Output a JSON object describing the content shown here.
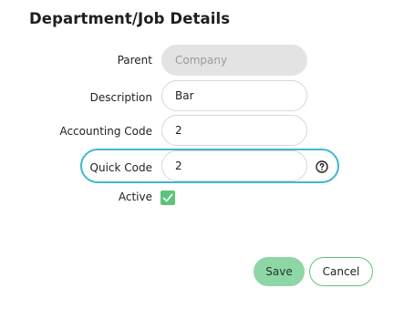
{
  "dialog": {
    "title": "Department/Job Details"
  },
  "fields": {
    "parent": {
      "label": "Parent",
      "value": "Company"
    },
    "description": {
      "label": "Description",
      "value": "Bar"
    },
    "accounting_code": {
      "label": "Accounting Code",
      "value": "2"
    },
    "quick_code": {
      "label": "Quick Code",
      "value": "2",
      "help_icon": "question-circle-icon"
    },
    "active": {
      "label": "Active",
      "checked": true
    }
  },
  "buttons": {
    "save_label": "Save",
    "cancel_label": "Cancel"
  },
  "colors": {
    "accent_green": "#5cc47a",
    "save_green": "#8fd6a6",
    "highlight_cyan": "#3fb8cf",
    "disabled_gray": "#e3e3e3"
  }
}
